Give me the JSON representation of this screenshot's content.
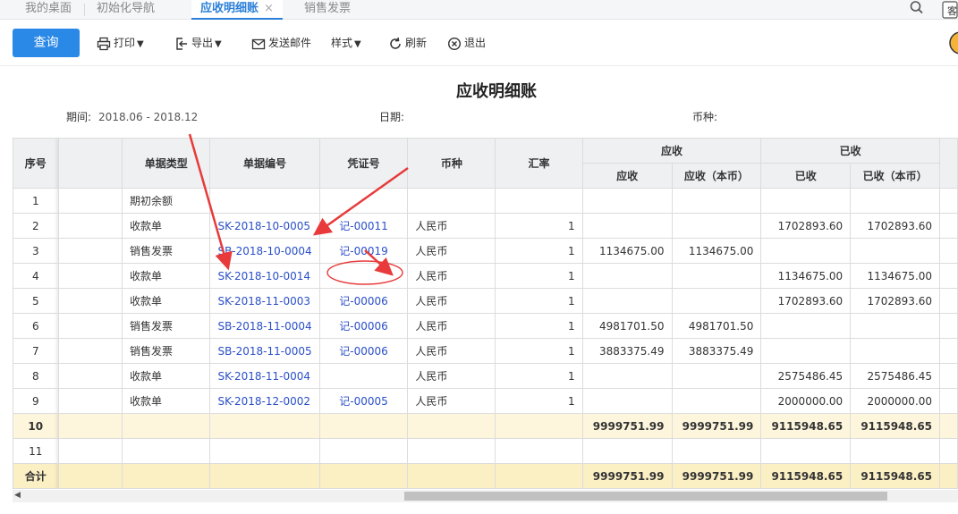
{
  "tabs": [
    {
      "label": "我的桌面",
      "active": false
    },
    {
      "label": "初始化导航",
      "active": false
    },
    {
      "label": "应收明细账",
      "active": true
    },
    {
      "label": "销售发票",
      "active": false
    }
  ],
  "tab_close_glyph": "×",
  "top_right": {
    "badge": "客"
  },
  "toolbar": {
    "query": "查询",
    "print": "打印",
    "export": "导出",
    "email": "发送邮件",
    "style": "样式",
    "refresh": "刷新",
    "exit": "退出"
  },
  "report": {
    "title": "应收明细账",
    "period_label": "期间:",
    "period_value": "2018.06 - 2018.12",
    "date_label": "日期:",
    "currency_label": "币种:"
  },
  "columns": {
    "seq": "序号",
    "doc_type": "单据类型",
    "doc_no": "单据编号",
    "voucher": "凭证号",
    "currency": "币种",
    "rate": "汇率",
    "receivable_group": "应收",
    "receivable": "应收",
    "receivable_local": "应收（本币）",
    "received_group": "已收",
    "received": "已收",
    "received_local": "已收（本币）"
  },
  "rows": [
    {
      "seq": "1",
      "type": "期初余额",
      "no": "",
      "voucher": "",
      "cur": "",
      "rate": "",
      "ar": "",
      "ar_local": "",
      "rec": "",
      "rec_local": ""
    },
    {
      "seq": "2",
      "type": "收款单",
      "no": "SK-2018-10-0005",
      "voucher": "记-00011",
      "cur": "人民币",
      "rate": "1",
      "ar": "",
      "ar_local": "",
      "rec": "1702893.60",
      "rec_local": "1702893.60"
    },
    {
      "seq": "3",
      "type": "销售发票",
      "no": "SB-2018-10-0004",
      "voucher": "记-00019",
      "cur": "人民币",
      "rate": "1",
      "ar": "1134675.00",
      "ar_local": "1134675.00",
      "rec": "",
      "rec_local": ""
    },
    {
      "seq": "4",
      "type": "收款单",
      "no": "SK-2018-10-0014",
      "voucher": "",
      "cur": "人民币",
      "rate": "1",
      "ar": "",
      "ar_local": "",
      "rec": "1134675.00",
      "rec_local": "1134675.00"
    },
    {
      "seq": "5",
      "type": "收款单",
      "no": "SK-2018-11-0003",
      "voucher": "记-00006",
      "cur": "人民币",
      "rate": "1",
      "ar": "",
      "ar_local": "",
      "rec": "1702893.60",
      "rec_local": "1702893.60"
    },
    {
      "seq": "6",
      "type": "销售发票",
      "no": "SB-2018-11-0004",
      "voucher": "记-00006",
      "cur": "人民币",
      "rate": "1",
      "ar": "4981701.50",
      "ar_local": "4981701.50",
      "rec": "",
      "rec_local": ""
    },
    {
      "seq": "7",
      "type": "销售发票",
      "no": "SB-2018-11-0005",
      "voucher": "记-00006",
      "cur": "人民币",
      "rate": "1",
      "ar": "3883375.49",
      "ar_local": "3883375.49",
      "rec": "",
      "rec_local": ""
    },
    {
      "seq": "8",
      "type": "收款单",
      "no": "SK-2018-11-0004",
      "voucher": "",
      "cur": "人民币",
      "rate": "1",
      "ar": "",
      "ar_local": "",
      "rec": "2575486.45",
      "rec_local": "2575486.45"
    },
    {
      "seq": "9",
      "type": "收款单",
      "no": "SK-2018-12-0002",
      "voucher": "记-00005",
      "cur": "人民币",
      "rate": "1",
      "ar": "",
      "ar_local": "",
      "rec": "2000000.00",
      "rec_local": "2000000.00"
    }
  ],
  "subtotal": {
    "seq": "10",
    "ar": "9999751.99",
    "ar_local": "9999751.99",
    "rec": "9115948.65",
    "rec_local": "9115948.65"
  },
  "empty_row": {
    "seq": "11"
  },
  "total": {
    "label": "合计",
    "ar": "9999751.99",
    "ar_local": "9999751.99",
    "rec": "9115948.65",
    "rec_local": "9115948.65"
  },
  "colors": {
    "accent": "#2a88e6",
    "link": "#2a4fc8",
    "annotation": "#e83a3a",
    "subtotal_bg": "#fdf6dd",
    "total_bg": "#fbefc4"
  }
}
